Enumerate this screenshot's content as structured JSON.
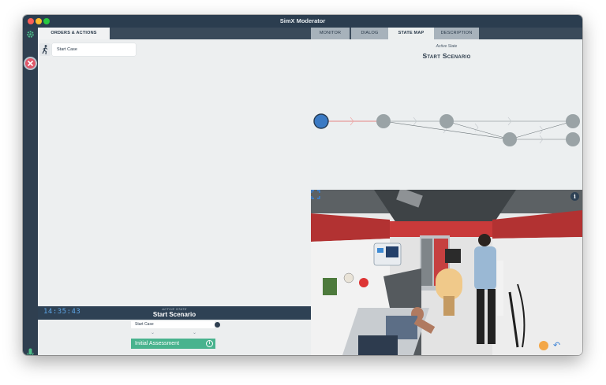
{
  "window": {
    "title": "SimX Moderator"
  },
  "tabs": {
    "orders": "ORDERS & ACTIONS",
    "monitor": "MONITOR",
    "dialog": "DIALOG",
    "state_map": "STATE MAP",
    "description": "DESCRIPTION"
  },
  "orders": {
    "item_label": "Start Case"
  },
  "active_state_bar": {
    "clock": "14:35:43",
    "caption": "ACTIVE STATE",
    "state": "Start Scenario"
  },
  "flow": {
    "start_label": "Start Case",
    "next_label": "Initial Assessment"
  },
  "state_map": {
    "caption": "Active State",
    "title": "Start Scenario",
    "active_color": "#3b7ac4",
    "node_color": "#9aa3a6",
    "active_edge_color": "#e06060"
  },
  "icons": {
    "gear": "gear-icon",
    "stop": "close-icon",
    "runner": "runner-icon",
    "mic": "microphone-icon",
    "info": "info-icon",
    "undo": "undo-icon",
    "fullscreen": "fullscreen-icon"
  }
}
